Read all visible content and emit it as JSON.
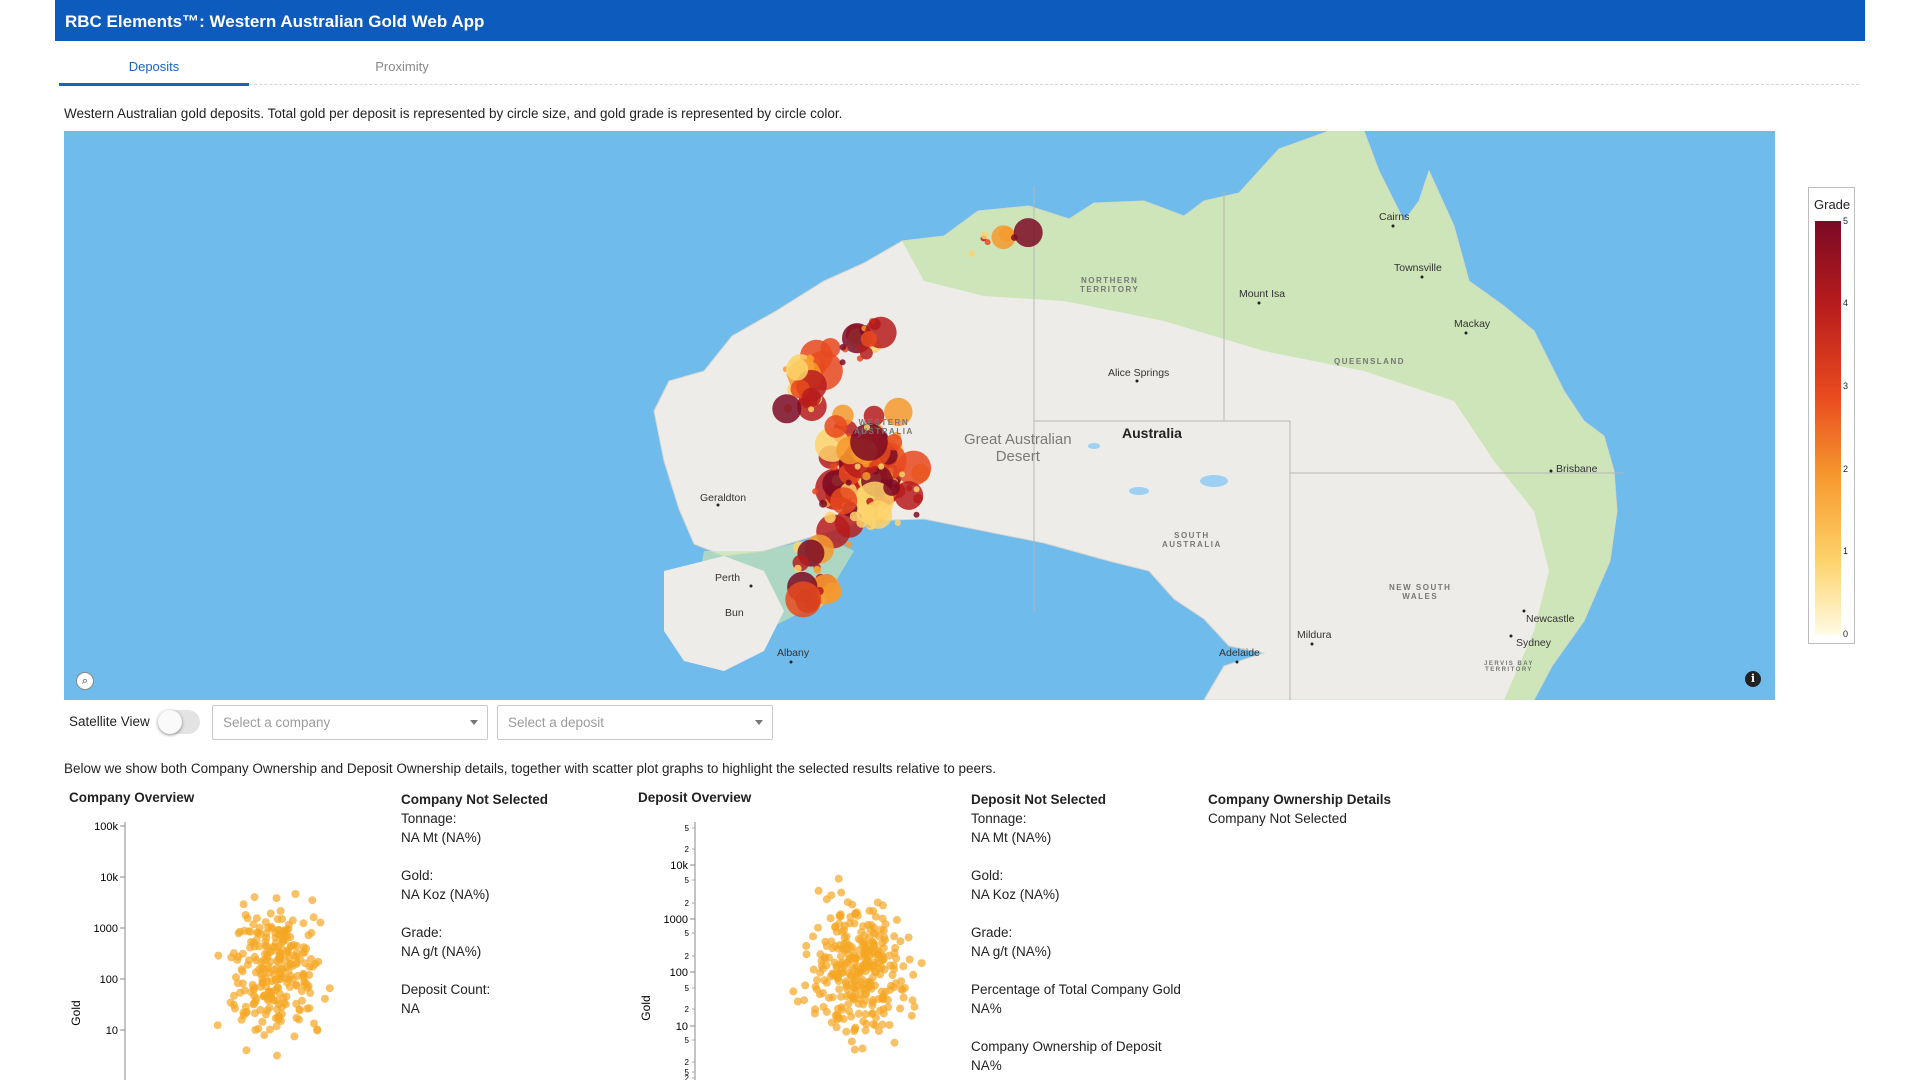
{
  "app": {
    "title": "RBC Elements™: Western Australian Gold Web App"
  },
  "tabs": [
    {
      "label": "Deposits",
      "active": true
    },
    {
      "label": "Proximity",
      "active": false
    }
  ],
  "intro_text": "Western Australian gold deposits. Total gold per deposit is represented by circle size, and gold grade is represented by circle color.",
  "map": {
    "country_label": "Australia",
    "desert_label_line1": "Great Australian",
    "desert_label_line2": "Desert",
    "regions": {
      "nt_line1": "NORTHERN",
      "nt_line2": "TERRITORY",
      "wa_line1": "WESTERN",
      "wa_line2": "AUSTRALIA",
      "qld": "QUEENSLAND",
      "sa_line1": "SOUTH",
      "sa_line2": "AUSTRALIA",
      "nsw_line1": "NEW SOUTH",
      "nsw_line2": "WALES",
      "jbt_line1": "JERVIS BAY",
      "jbt_line2": "TERRITORY"
    },
    "cities": {
      "cairns": "Cairns",
      "townsville": "Townsville",
      "mackay": "Mackay",
      "mount_isa": "Mount Isa",
      "alice_springs": "Alice Springs",
      "brisbane": "Brisbane",
      "geraldton": "Geraldton",
      "perth": "Perth",
      "bunbury": "Bun",
      "albany": "Albany",
      "adelaide": "Adelaide",
      "mildura": "Mildura",
      "newcastle": "Newcastle",
      "sydney": "Sydney"
    },
    "colors": {
      "ocean": "#6fbbec",
      "land": "#eeece8",
      "tropical": "#c8e3b0",
      "border": "#b7b7b7"
    },
    "icons": {
      "search": "search-icon",
      "info": "info-icon"
    }
  },
  "legend": {
    "title": "Grade",
    "ticks": [
      "5",
      "4",
      "3",
      "2",
      "1",
      "0"
    ],
    "colors": [
      "#7b0a24",
      "#b71c1c",
      "#e84a1e",
      "#f69a2e",
      "#fdd36b",
      "#fffbe5"
    ]
  },
  "controls": {
    "satellite_label": "Satellite View",
    "satellite_on": false,
    "company_placeholder": "Select a company",
    "deposit_placeholder": "Select a deposit"
  },
  "details_text": "Below we show both Company Ownership and Deposit Ownership details, together with scatter plot graphs to highlight the selected results relative to peers.",
  "company_overview": {
    "title": "Company Overview",
    "y_label": "Gold",
    "y_ticks": [
      "100k",
      "10k",
      "1000",
      "100",
      "10"
    ],
    "point_color": "#f5a623"
  },
  "company_details": {
    "title": "Company Not Selected",
    "tonnage_label": "Tonnage:",
    "tonnage_value": "NA Mt (NA%)",
    "gold_label": "Gold:",
    "gold_value": "NA Koz (NA%)",
    "grade_label": "Grade:",
    "grade_value": "NA g/t (NA%)",
    "count_label": "Deposit Count:",
    "count_value": "NA"
  },
  "deposit_overview": {
    "title": "Deposit Overview",
    "y_label": "Gold",
    "major_ticks": [
      "10k",
      "1000",
      "100",
      "10"
    ],
    "minor_ticks": [
      "5",
      "2",
      "5",
      "2",
      "5",
      "2",
      "5",
      "2",
      "5",
      "2",
      "5",
      "2"
    ],
    "point_color": "#f5a623"
  },
  "deposit_details": {
    "title": "Deposit Not Selected",
    "tonnage_label": "Tonnage:",
    "tonnage_value": "NA Mt (NA%)",
    "gold_label": "Gold:",
    "gold_value": "NA Koz (NA%)",
    "grade_label": "Grade:",
    "grade_value": "NA g/t (NA%)",
    "pct_label": "Percentage of Total Company Gold",
    "pct_value": "NA%",
    "own_label": "Company Ownership of Deposit",
    "own_value": "NA%"
  },
  "ownership": {
    "title": "Company Ownership Details",
    "value": "Company Not Selected"
  }
}
